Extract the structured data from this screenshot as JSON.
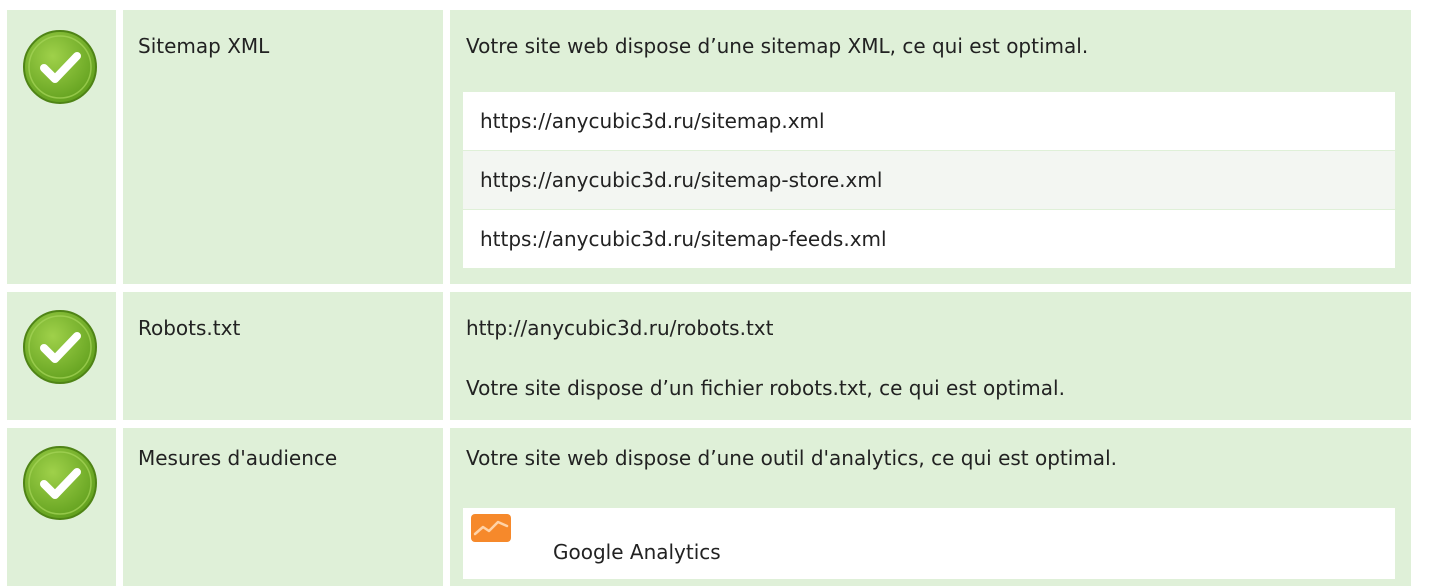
{
  "colors": {
    "cell_background": "#dff0d8",
    "check_green": "#7ab52a",
    "check_border": "#5b8f1d",
    "analytics_orange": "#f6892b"
  },
  "rows": [
    {
      "status_icon": "check-circle-icon",
      "label": "Sitemap XML",
      "message": "Votre site web dispose d’une sitemap XML, ce qui est optimal.",
      "items": [
        "https://anycubic3d.ru/sitemap.xml",
        "https://anycubic3d.ru/sitemap-store.xml",
        "https://anycubic3d.ru/sitemap-feeds.xml"
      ]
    },
    {
      "status_icon": "check-circle-icon",
      "label": "Robots.txt",
      "url": "http://anycubic3d.ru/robots.txt",
      "message": "Votre site dispose d’un fichier robots.txt, ce qui est optimal."
    },
    {
      "status_icon": "check-circle-icon",
      "label": "Mesures d'audience",
      "message": "Votre site web dispose d’une outil d'analytics, ce qui est optimal.",
      "tools": [
        {
          "icon": "google-analytics-icon",
          "name": "Google Analytics"
        }
      ]
    }
  ]
}
